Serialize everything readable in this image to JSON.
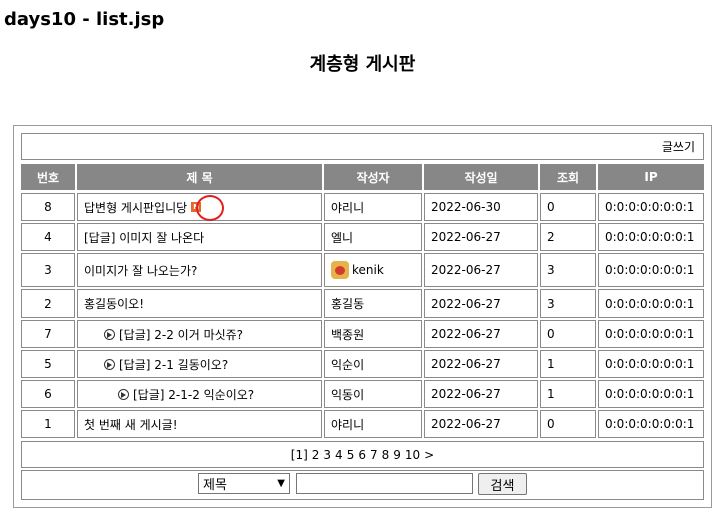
{
  "header": {
    "title": "days10 - list.jsp"
  },
  "board": {
    "title": "계층형 게시판",
    "write_label": "글쓰기",
    "columns": [
      "번호",
      "제 목",
      "작성자",
      "작성일",
      "조회",
      "IP"
    ],
    "rows": [
      {
        "no": "8",
        "title": "답변형 게시판입니당",
        "reply_depth": 0,
        "new": true,
        "writer": "야리니",
        "avatar": false,
        "date": "2022-06-30",
        "views": "0",
        "ip": "0:0:0:0:0:0:0:1"
      },
      {
        "no": "4",
        "title": "[답글] 이미지 잘 나온다",
        "reply_depth": 0,
        "new": false,
        "writer": "엘니",
        "avatar": false,
        "date": "2022-06-27",
        "views": "2",
        "ip": "0:0:0:0:0:0:0:1"
      },
      {
        "no": "3",
        "title": "이미지가 잘 나오는가?",
        "reply_depth": 0,
        "new": false,
        "writer": "kenik",
        "avatar": true,
        "date": "2022-06-27",
        "views": "3",
        "ip": "0:0:0:0:0:0:0:1"
      },
      {
        "no": "2",
        "title": "홍길동이오!",
        "reply_depth": 0,
        "new": false,
        "writer": "홍길동",
        "avatar": false,
        "date": "2022-06-27",
        "views": "3",
        "ip": "0:0:0:0:0:0:0:1"
      },
      {
        "no": "7",
        "title": "[답글] 2-2 이거 마싯쥬?",
        "reply_depth": 1,
        "new": false,
        "writer": "백종원",
        "avatar": false,
        "date": "2022-06-27",
        "views": "0",
        "ip": "0:0:0:0:0:0:0:1"
      },
      {
        "no": "5",
        "title": "[답글] 2-1 길동이오?",
        "reply_depth": 1,
        "new": false,
        "writer": "익순이",
        "avatar": false,
        "date": "2022-06-27",
        "views": "1",
        "ip": "0:0:0:0:0:0:0:1"
      },
      {
        "no": "6",
        "title": "[답글] 2-1-2 익순이오?",
        "reply_depth": 2,
        "new": false,
        "writer": "익동이",
        "avatar": false,
        "date": "2022-06-27",
        "views": "1",
        "ip": "0:0:0:0:0:0:0:1"
      },
      {
        "no": "1",
        "title": "첫 번째 새 게시글!",
        "reply_depth": 0,
        "new": false,
        "writer": "야리니",
        "avatar": false,
        "date": "2022-06-27",
        "views": "0",
        "ip": "0:0:0:0:0:0:0:1"
      }
    ],
    "pagination": {
      "current": "[1]",
      "pages": [
        "2",
        "3",
        "4",
        "5",
        "6",
        "7",
        "8",
        "9",
        "10"
      ],
      "next": ">"
    },
    "search": {
      "field_selected": "제목",
      "query_value": "",
      "button_label": "검색"
    },
    "new_badge": "N"
  }
}
